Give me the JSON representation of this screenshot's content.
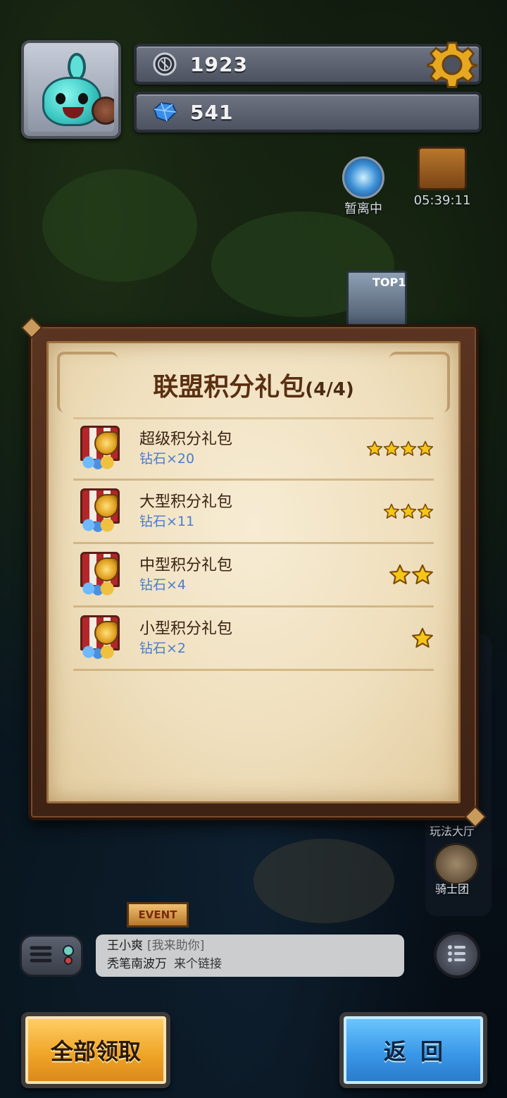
{
  "hud": {
    "coins": "1923",
    "gems": "541"
  },
  "map": {
    "portal_label": "暂离中",
    "chest_timer": "05:39:11",
    "top_badge": "TOP1",
    "side_hall_label": "玩法大厅",
    "side_knight_label": "骑士团",
    "event_sign": "EVENT"
  },
  "modal": {
    "title": "联盟积分礼包",
    "count": "(4/4)",
    "packs": [
      {
        "name": "超级积分礼包",
        "reward": "钻石×20",
        "stars": 4
      },
      {
        "name": "大型积分礼包",
        "reward": "钻石×11",
        "stars": 3
      },
      {
        "name": "中型积分礼包",
        "reward": "钻石×4",
        "stars": 2
      },
      {
        "name": "小型积分礼包",
        "reward": "钻石×2",
        "stars": 1
      }
    ]
  },
  "chat": {
    "line1_user": "王小爽",
    "line1_tag": "[我来助你]",
    "line2_user": "秃笔南波万",
    "line2_msg": "来个链接"
  },
  "buttons": {
    "claim_all": "全部领取",
    "back": "返回"
  },
  "colors": {
    "claim_button": "#f0a628",
    "back_button": "#3a98e8",
    "reward_text": "#4c7ccc",
    "star": "#f5c518"
  }
}
